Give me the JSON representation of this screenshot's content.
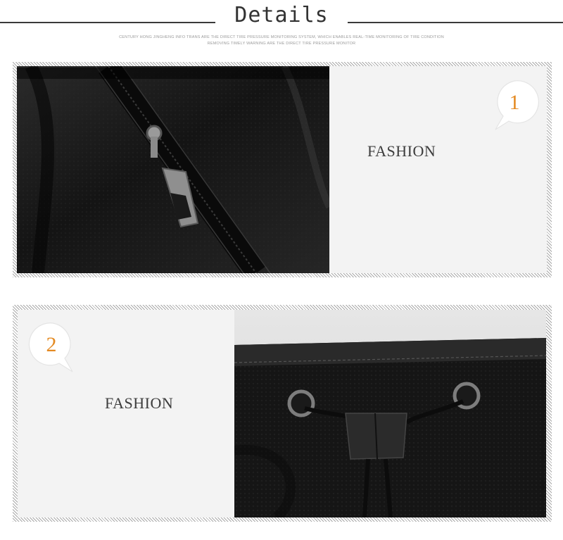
{
  "header": {
    "title": "Details",
    "subtitle_line1": "Century Hong Jingheng info trans are the direct tire pressure monitoring system, which enables real-time monitoring of tire condition",
    "subtitle_line2": "removing timely warning are the direct tire pressure monitor"
  },
  "panels": [
    {
      "number": "1",
      "label": "FASHION",
      "photo_icon": "zipper-leather-photo",
      "accent_color": "#e48a22"
    },
    {
      "number": "2",
      "label": "FASHION",
      "photo_icon": "drawstring-leather-photo",
      "accent_color": "#e48a22"
    }
  ]
}
